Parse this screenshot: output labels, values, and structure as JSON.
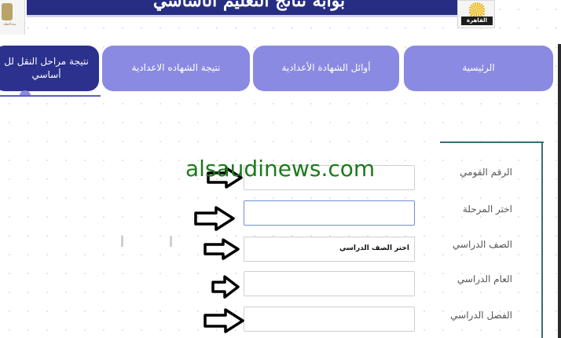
{
  "header": {
    "title": "بوابة نتائج التعليم الأساسي",
    "left_logo_text": "محافظة",
    "right_logo_text": "القاهرة"
  },
  "nav": {
    "tabs": [
      {
        "label": "الرئيسية",
        "active": false
      },
      {
        "label": "أوائل الشهادة الأعدادية",
        "active": false
      },
      {
        "label": "نتيجة الشهاده الاعدادية",
        "active": false
      },
      {
        "label_line1": "نتيجة مراحل النقل لل",
        "label_line2": "أساسي",
        "active": true
      }
    ]
  },
  "form": {
    "national_id_label": "الرقم القومي",
    "stage_label": "اختر المرحلة",
    "grade_label": "الصف الدراسي",
    "grade_value": "اختر الصف الدراسي",
    "year_label": "العام الدراسي",
    "term_label": "الفصل الدراسي"
  },
  "watermark": "alsaudinews.com",
  "colors": {
    "banner": "#262d83",
    "tab": "#8a8ae2",
    "tab_active": "#2b318d",
    "watermark": "#1c7a1c"
  },
  "icons": [
    "arrow-right-icon"
  ]
}
